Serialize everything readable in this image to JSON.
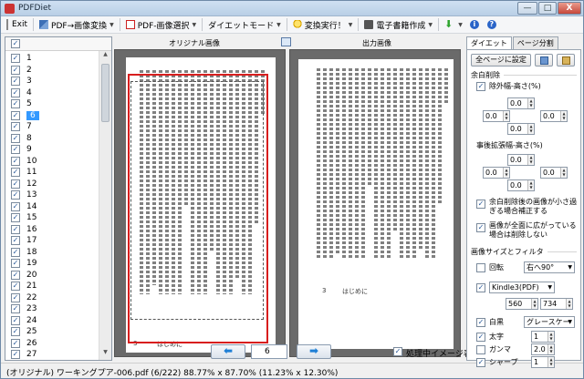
{
  "app": {
    "title": "PDFDiet"
  },
  "window_controls": {
    "minimize": "—",
    "maximize": "□",
    "close": "X"
  },
  "menu": {
    "exit": "Exit",
    "pdf_to_image": "PDF→画像変換",
    "pdf_image_select": "PDF-画像選択",
    "diet_mode": "ダイエットモード",
    "run_convert": "変換実行！",
    "ebook_create": "電子書籍作成"
  },
  "pages": {
    "items": [
      "1",
      "2",
      "3",
      "4",
      "5",
      "6",
      "7",
      "8",
      "9",
      "10",
      "11",
      "12",
      "13",
      "14",
      "15",
      "16",
      "17",
      "18",
      "19",
      "20",
      "21",
      "22",
      "23",
      "24",
      "25",
      "26",
      "27"
    ],
    "selected": "6"
  },
  "center": {
    "label_original": "オリジナル画像",
    "label_output": "出力画像",
    "page_number_left": "3",
    "page_number_label_left": "はじめに",
    "page_number_right": "3",
    "page_number_label_right": "はじめに"
  },
  "nav": {
    "prev_arrow": "⬅",
    "next_arrow": "➡",
    "page_value": "6",
    "show_processing_label": "処理中イメージ表示"
  },
  "status": {
    "text": "(オリジナル) ワーキングプア-006.pdf (6/222)  88.77% x 87.70% (11.23% x 12.30%)"
  },
  "right": {
    "tab_diet": "ダイエット",
    "tab_page_split": "ページ分割",
    "apply_all": "全ページに設定",
    "margin_removal": "余白削除",
    "margin_width_height": "除外幅-高さ(%)",
    "post_expand": "事後拡張幅-高さ(%)",
    "small_image_fix": "余白削除後の画像が小さ過ぎる場合補正する",
    "full_image_no_delete": "画像が全面に広がっている場合は削除しない",
    "image_size_filter": "画像サイズとフィルタ",
    "rotate": "回転",
    "rotate_value": "右へ90°",
    "kindle_value": "Kindle3(PDF)",
    "width": "560",
    "height": "734",
    "whiten": "白黒",
    "whiten_value": "グレースケー",
    "bold": "太字",
    "bold_value": "1",
    "gamma": "ガンマ",
    "gamma_value": "2.0",
    "sharpen": "シャープ",
    "sharpen_value": "1",
    "spin_values": [
      "0.0",
      "0.0",
      "0.0",
      "0.0",
      "0.0",
      "0.0",
      "0.0",
      "0.0"
    ]
  }
}
